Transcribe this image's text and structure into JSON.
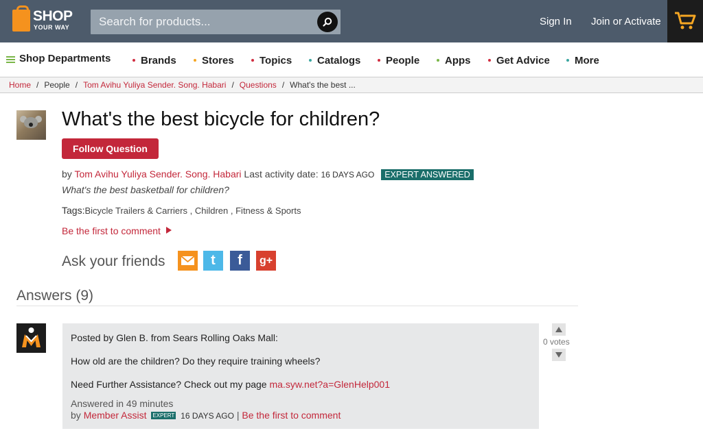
{
  "header": {
    "logo_top": "SHOP",
    "logo_bottom": "YOUR WAY",
    "search_placeholder": "Search for products...",
    "sign_in": "Sign In",
    "join": "Join or Activate"
  },
  "nav": {
    "departments": "Shop Departments",
    "items": [
      {
        "label": "Brands",
        "dot_color": "#d12d40"
      },
      {
        "label": "Stores",
        "dot_color": "#f5a623"
      },
      {
        "label": "Topics",
        "dot_color": "#d12d40"
      },
      {
        "label": "Catalogs",
        "dot_color": "#3aa6a0"
      },
      {
        "label": "People",
        "dot_color": "#d12d40"
      },
      {
        "label": "Apps",
        "dot_color": "#7ab648"
      },
      {
        "label": "Get Advice",
        "dot_color": "#d12d40"
      },
      {
        "label": "More",
        "dot_color": "#3aa6a0"
      }
    ]
  },
  "breadcrumb": {
    "items": [
      "Home",
      "People",
      "Tom Avihu Yuliya Sender. Song. Habari",
      "Questions",
      "What's the best ..."
    ],
    "separator": "/"
  },
  "question": {
    "title": "What's the best bicycle for children?",
    "follow_label": "Follow Question",
    "by": "by",
    "author": "Tom Avihu Yuliya Sender. Song. Habari",
    "last_activity_label": "Last activity date:",
    "last_activity": "16 DAYS AGO",
    "badge": "EXPERT ANSWERED",
    "description": "What's the best basketball for children?",
    "tags_label": "Tags:",
    "tags": [
      "Bicycle Trailers & Carriers",
      "Children",
      "Fitness & Sports"
    ],
    "comment_link": "Be the first to comment",
    "ask_friends": "Ask your friends"
  },
  "answers": {
    "heading": "Answers (9)",
    "items": [
      {
        "posted_by": "Posted by Glen B. from Sears Rolling Oaks Mall:",
        "body": "How old are the children? Do they require training wheels?",
        "assist_text": "Need Further Assistance? Check out my page",
        "assist_link": "ma.syw.net?a=GlenHelp001",
        "answered_in": "Answered in 49 minutes",
        "by": "by",
        "author": "Member Assist",
        "expert_tag": "EXPERT",
        "date": "16 DAYS AGO",
        "divider": "|",
        "comment_link": "Be the first to comment",
        "votes": "0 votes"
      }
    ]
  },
  "colors": {
    "header_bg": "#4d5b6b",
    "brand_red": "#c3273a",
    "badge_teal": "#1a6e6a",
    "logo_orange": "#f5921e"
  }
}
